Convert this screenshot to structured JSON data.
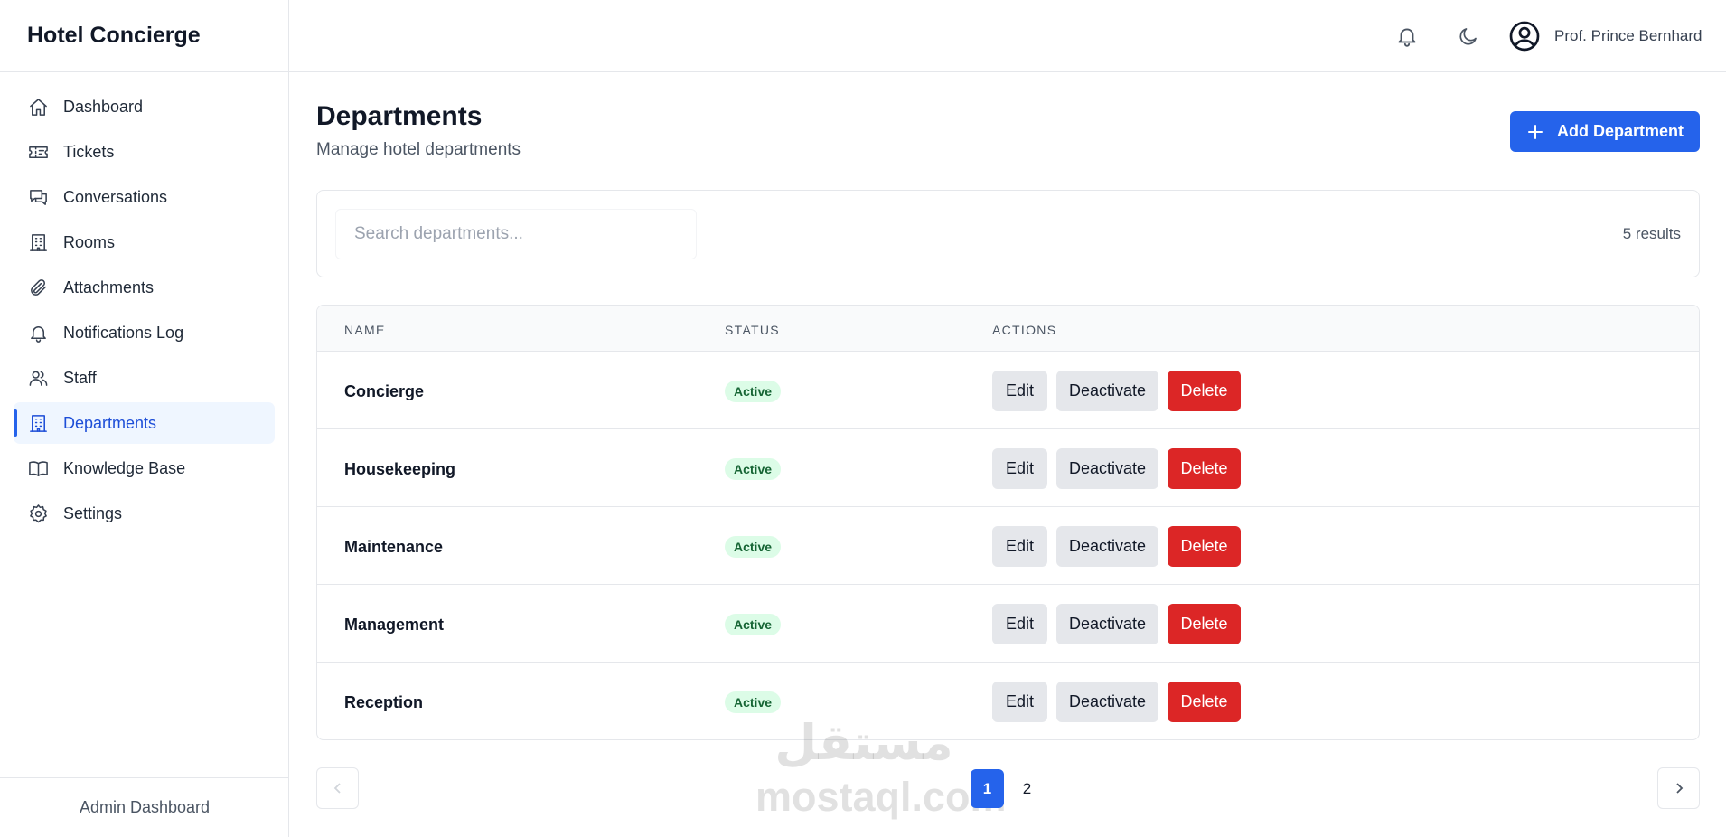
{
  "app": {
    "title": "Hotel Concierge"
  },
  "sidebar": {
    "items": [
      {
        "label": "Dashboard",
        "icon": "home-icon"
      },
      {
        "label": "Tickets",
        "icon": "ticket-icon"
      },
      {
        "label": "Conversations",
        "icon": "chat-bubbles-icon"
      },
      {
        "label": "Rooms",
        "icon": "building-icon"
      },
      {
        "label": "Attachments",
        "icon": "paperclip-icon"
      },
      {
        "label": "Notifications Log",
        "icon": "bell-icon"
      },
      {
        "label": "Staff",
        "icon": "users-icon"
      },
      {
        "label": "Departments",
        "icon": "building-icon",
        "active": true
      },
      {
        "label": "Knowledge Base",
        "icon": "book-icon"
      },
      {
        "label": "Settings",
        "icon": "gear-icon"
      }
    ],
    "footer": "Admin Dashboard"
  },
  "header": {
    "user_name": "Prof. Prince Bernhard",
    "icons": [
      "bell-icon",
      "moon-icon",
      "user-circle-icon"
    ]
  },
  "page": {
    "title": "Departments",
    "subtitle": "Manage hotel departments",
    "add_button": "Add Department"
  },
  "search": {
    "placeholder": "Search departments...",
    "value": "",
    "results": "5 results"
  },
  "table": {
    "columns": [
      "NAME",
      "STATUS",
      "ACTIONS"
    ],
    "rows": [
      {
        "name": "Concierge",
        "status": "Active"
      },
      {
        "name": "Housekeeping",
        "status": "Active"
      },
      {
        "name": "Maintenance",
        "status": "Active"
      },
      {
        "name": "Management",
        "status": "Active"
      },
      {
        "name": "Reception",
        "status": "Active"
      }
    ],
    "actions": {
      "edit": "Edit",
      "deactivate": "Deactivate",
      "delete": "Delete"
    }
  },
  "pagination": {
    "pages": [
      "1",
      "2"
    ],
    "current": "1"
  },
  "watermark": {
    "arabic": "مستقل",
    "latin": "mostaql.com"
  },
  "colors": {
    "primary": "#2563eb",
    "danger": "#dc2626",
    "success_bg": "#dcfce7",
    "success_text": "#166534",
    "active_nav_bg": "#eff6ff"
  }
}
